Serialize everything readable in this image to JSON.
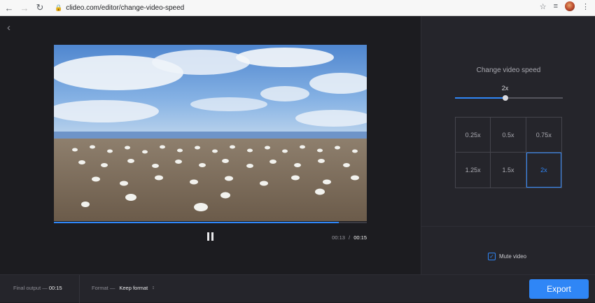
{
  "browser": {
    "url": "clideo.com/editor/change-video-speed",
    "icons": [
      "back-arrow-icon",
      "forward-arrow-icon",
      "lock-icon",
      "star-icon",
      "playlist-icon",
      "avatar",
      "more-vert-icon"
    ]
  },
  "player": {
    "current_time": "00:13",
    "time_separator": "/",
    "total_time": "00:15",
    "progress": 0.91
  },
  "panel": {
    "title": "Change video speed",
    "speed_value": "2x",
    "slider_level": 0.47,
    "speed_options": [
      "0.25x",
      "0.5x",
      "0.75x",
      "1.25x",
      "1.5x",
      "2x"
    ],
    "selected_option": "2x",
    "mute_label": "Mute video",
    "mute_checked": true
  },
  "footer": {
    "final_output_label": "Final output —",
    "final_output_value": "00:15",
    "format_label": "Format —",
    "format_value": "Keep format",
    "export_label": "Export"
  },
  "colors": {
    "accent": "#2f86f6",
    "background": "#1c1c20",
    "panel": "#25252b"
  }
}
